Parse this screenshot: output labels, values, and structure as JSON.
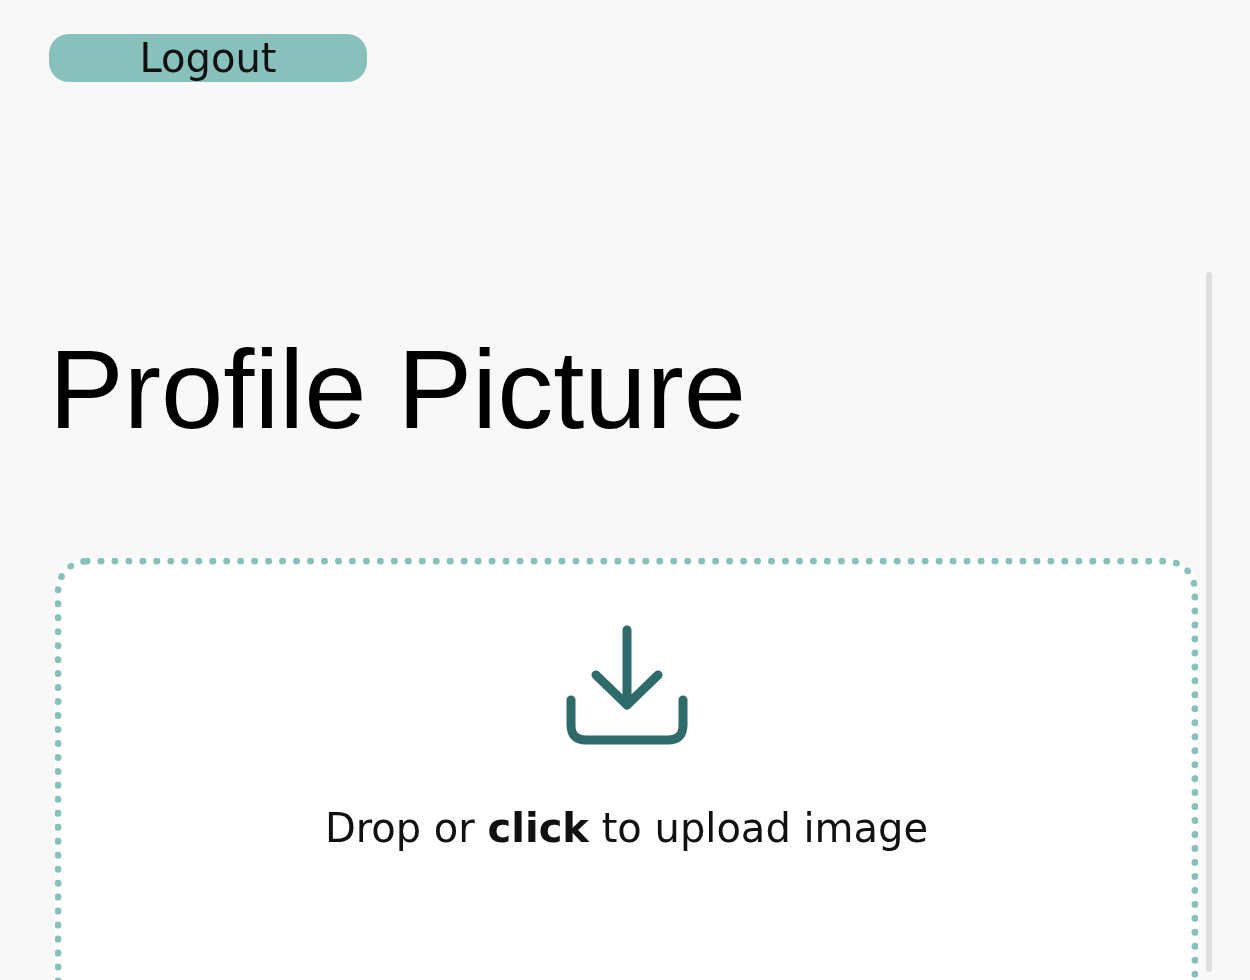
{
  "logout_button": {
    "label": "Logout"
  },
  "heading": "Profile Picture",
  "upload": {
    "prompt": "Drop or **click** to upload image"
  }
}
